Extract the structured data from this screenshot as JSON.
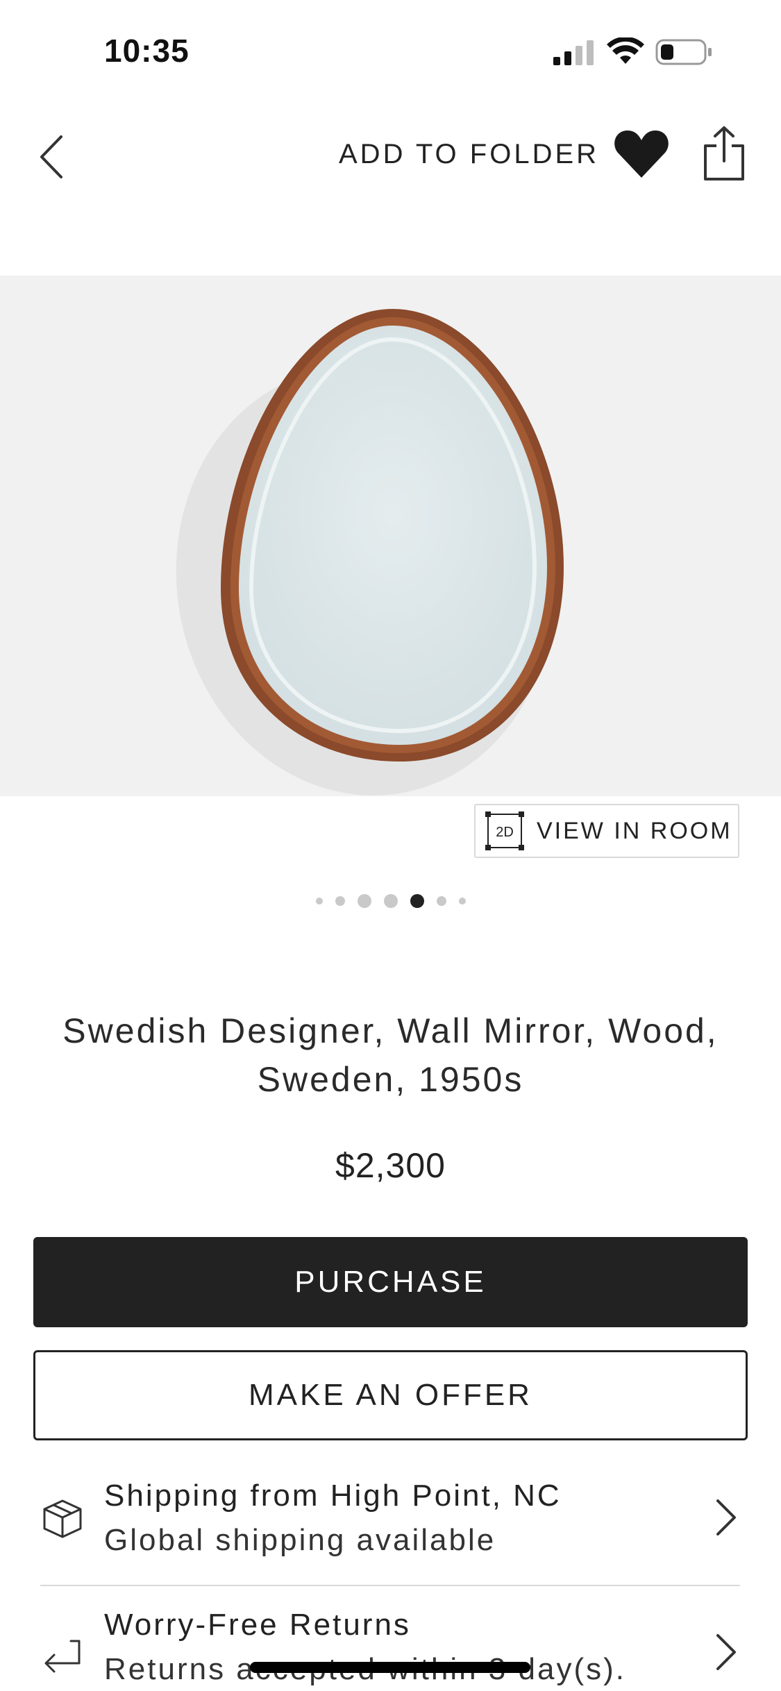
{
  "status_bar": {
    "time": "10:35",
    "signal_icon": "cellular-signal-icon",
    "wifi_icon": "wifi-icon",
    "battery_icon": "battery-low-icon"
  },
  "header": {
    "back_icon": "chevron-left-icon",
    "add_to_folder_label": "ADD TO FOLDER",
    "favorite_icon": "heart-filled-icon",
    "share_icon": "share-icon"
  },
  "product": {
    "image_description_icon": "oval-wall-mirror-image",
    "view_in_room_icon_text": "2D",
    "view_in_room_label": "VIEW IN ROOM",
    "carousel": {
      "total": 7,
      "active_index": 4
    },
    "title": "Swedish Designer, Wall Mirror, Wood, Sweden, 1950s",
    "price": "$2,300"
  },
  "actions": {
    "purchase_label": "PURCHASE",
    "offer_label": "MAKE AN OFFER"
  },
  "info": {
    "shipping": {
      "icon": "package-box-icon",
      "title": "Shipping from High Point, NC",
      "subtitle": "Global shipping available"
    },
    "returns": {
      "icon": "return-arrow-icon",
      "title": "Worry-Free Returns",
      "subtitle": "Returns accepted within 3 day(s)."
    }
  },
  "colors": {
    "dark_button": "#222222",
    "image_background": "#f1f1f1",
    "frame_wood": "#8a4a2b"
  }
}
